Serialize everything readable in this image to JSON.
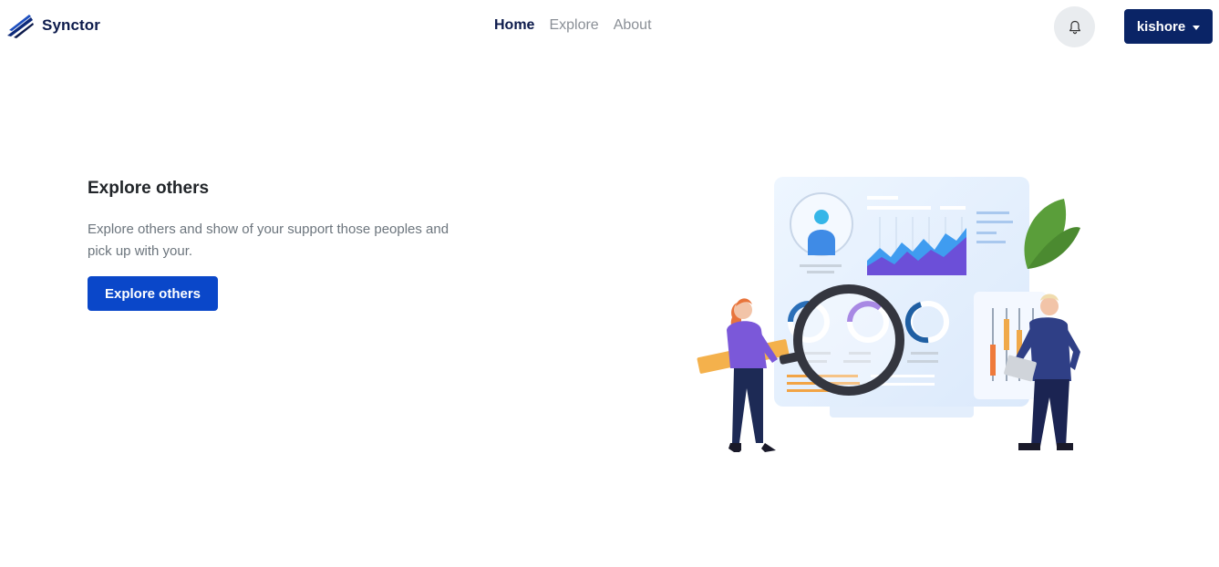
{
  "header": {
    "brand": "Synctor",
    "nav": [
      {
        "label": "Home",
        "active": true
      },
      {
        "label": "Explore",
        "active": false
      },
      {
        "label": "About",
        "active": false
      }
    ],
    "notifications_icon": "bell-icon",
    "user_menu": {
      "label": "kishore",
      "icon": "caret-down-icon"
    }
  },
  "hero": {
    "title": "Explore others",
    "description": "Explore others and show of your support those peoples and pick up with your.",
    "cta_label": "Explore others"
  },
  "colors": {
    "brand_dark": "#0d1b4c",
    "user_button": "#0a2466",
    "cta_button": "#0a47c9",
    "muted_text": "#6c757d"
  }
}
